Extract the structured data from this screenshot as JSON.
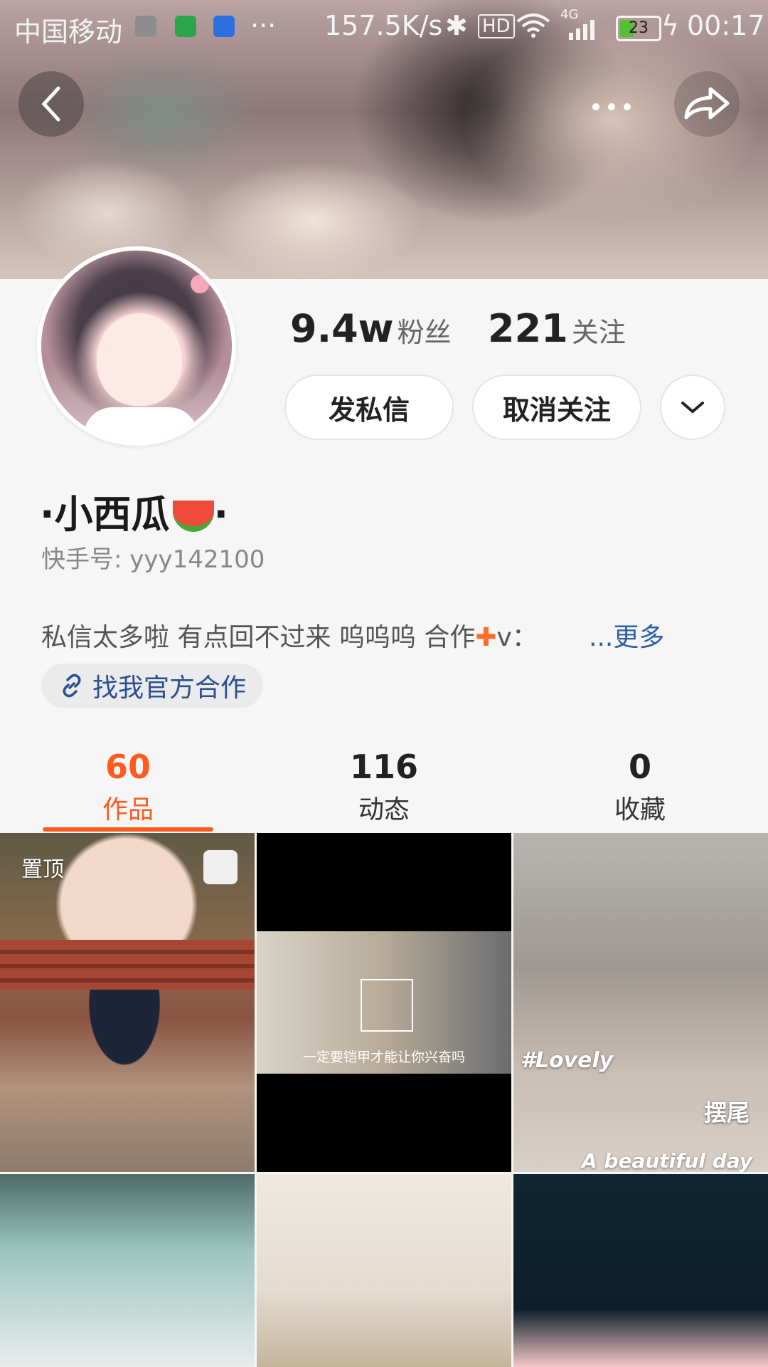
{
  "status_bar": {
    "carrier": "中国移动",
    "speed": "157.5K/s",
    "network": "4G",
    "battery": "23",
    "time": "00:17"
  },
  "cover": {
    "icons": {
      "back": "back-arrow-icon",
      "more": "more-dots-icon",
      "share": "share-arrow-icon"
    }
  },
  "profile": {
    "followers_count": "9.4w",
    "followers_label": "粉丝",
    "following_count": "221",
    "following_label": "关注",
    "message_button": "发私信",
    "unfollow_button": "取消关注",
    "name": "·小西瓜",
    "name_suffix": "·",
    "kuaishou_id": "快手号: yyy142100",
    "bio": "私信太多啦 有点回不过来 呜呜呜 合作",
    "bio_suffix": "v：",
    "more": "...更多",
    "cooperation_link": "找我官方合作"
  },
  "tabs": [
    {
      "count": "60",
      "label": "作品",
      "active": true
    },
    {
      "count": "116",
      "label": "动态",
      "active": false
    },
    {
      "count": "0",
      "label": "收藏",
      "active": false
    }
  ],
  "grid": {
    "pinned_label": "置顶",
    "video2_caption": "一定要铠甲才能让你兴奋吗",
    "video3_tag1": "#Lovely",
    "video3_tag2": "摆尾",
    "video3_tag3": "A beautiful day"
  },
  "colors": {
    "accent": "#ff5a1f",
    "link": "#2a5ea8"
  }
}
